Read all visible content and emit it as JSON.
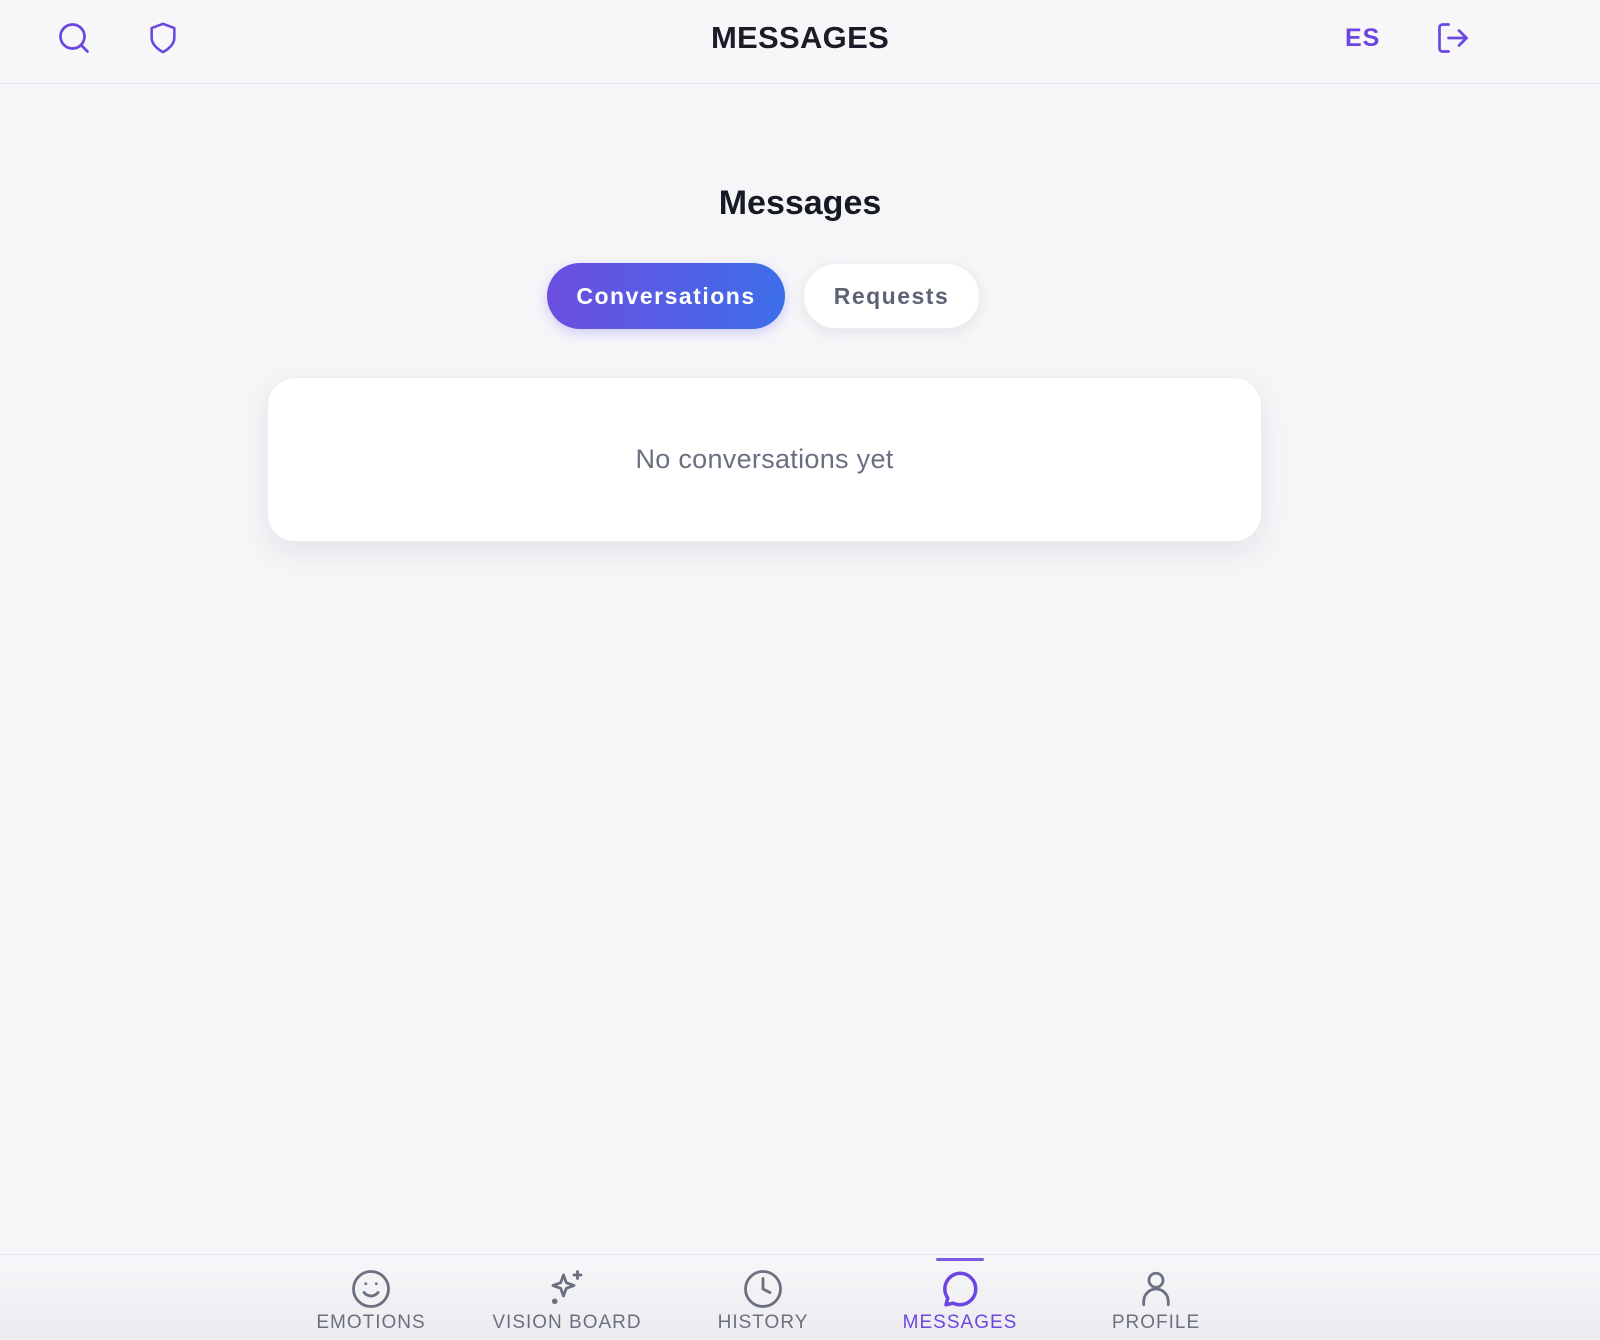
{
  "header": {
    "title": "MESSAGES",
    "lang_label": "ES",
    "icons": {
      "search": "search-icon",
      "shield": "shield-icon",
      "logout": "logout-icon"
    },
    "accent": "#6b46e0"
  },
  "main": {
    "title": "Messages",
    "tabs": [
      {
        "label": "Conversations",
        "active": true
      },
      {
        "label": "Requests",
        "active": false
      }
    ],
    "empty_message": "No conversations yet"
  },
  "bottom_nav": {
    "items": [
      {
        "label": "EMOTIONS",
        "icon": "smile-icon",
        "active": false
      },
      {
        "label": "VISION BOARD",
        "icon": "sparkles-icon",
        "active": false
      },
      {
        "label": "HISTORY",
        "icon": "clock-icon",
        "active": false
      },
      {
        "label": "MESSAGES",
        "icon": "chat-bubble-icon",
        "active": true
      },
      {
        "label": "PROFILE",
        "icon": "user-icon",
        "active": false
      }
    ],
    "active_color": "#6b46e0",
    "inactive_color": "#6b7080"
  },
  "colors": {
    "tab_gradient_start": "#6c4ee0",
    "tab_gradient_end": "#3c6ee8",
    "background": "#f6f6f9"
  }
}
